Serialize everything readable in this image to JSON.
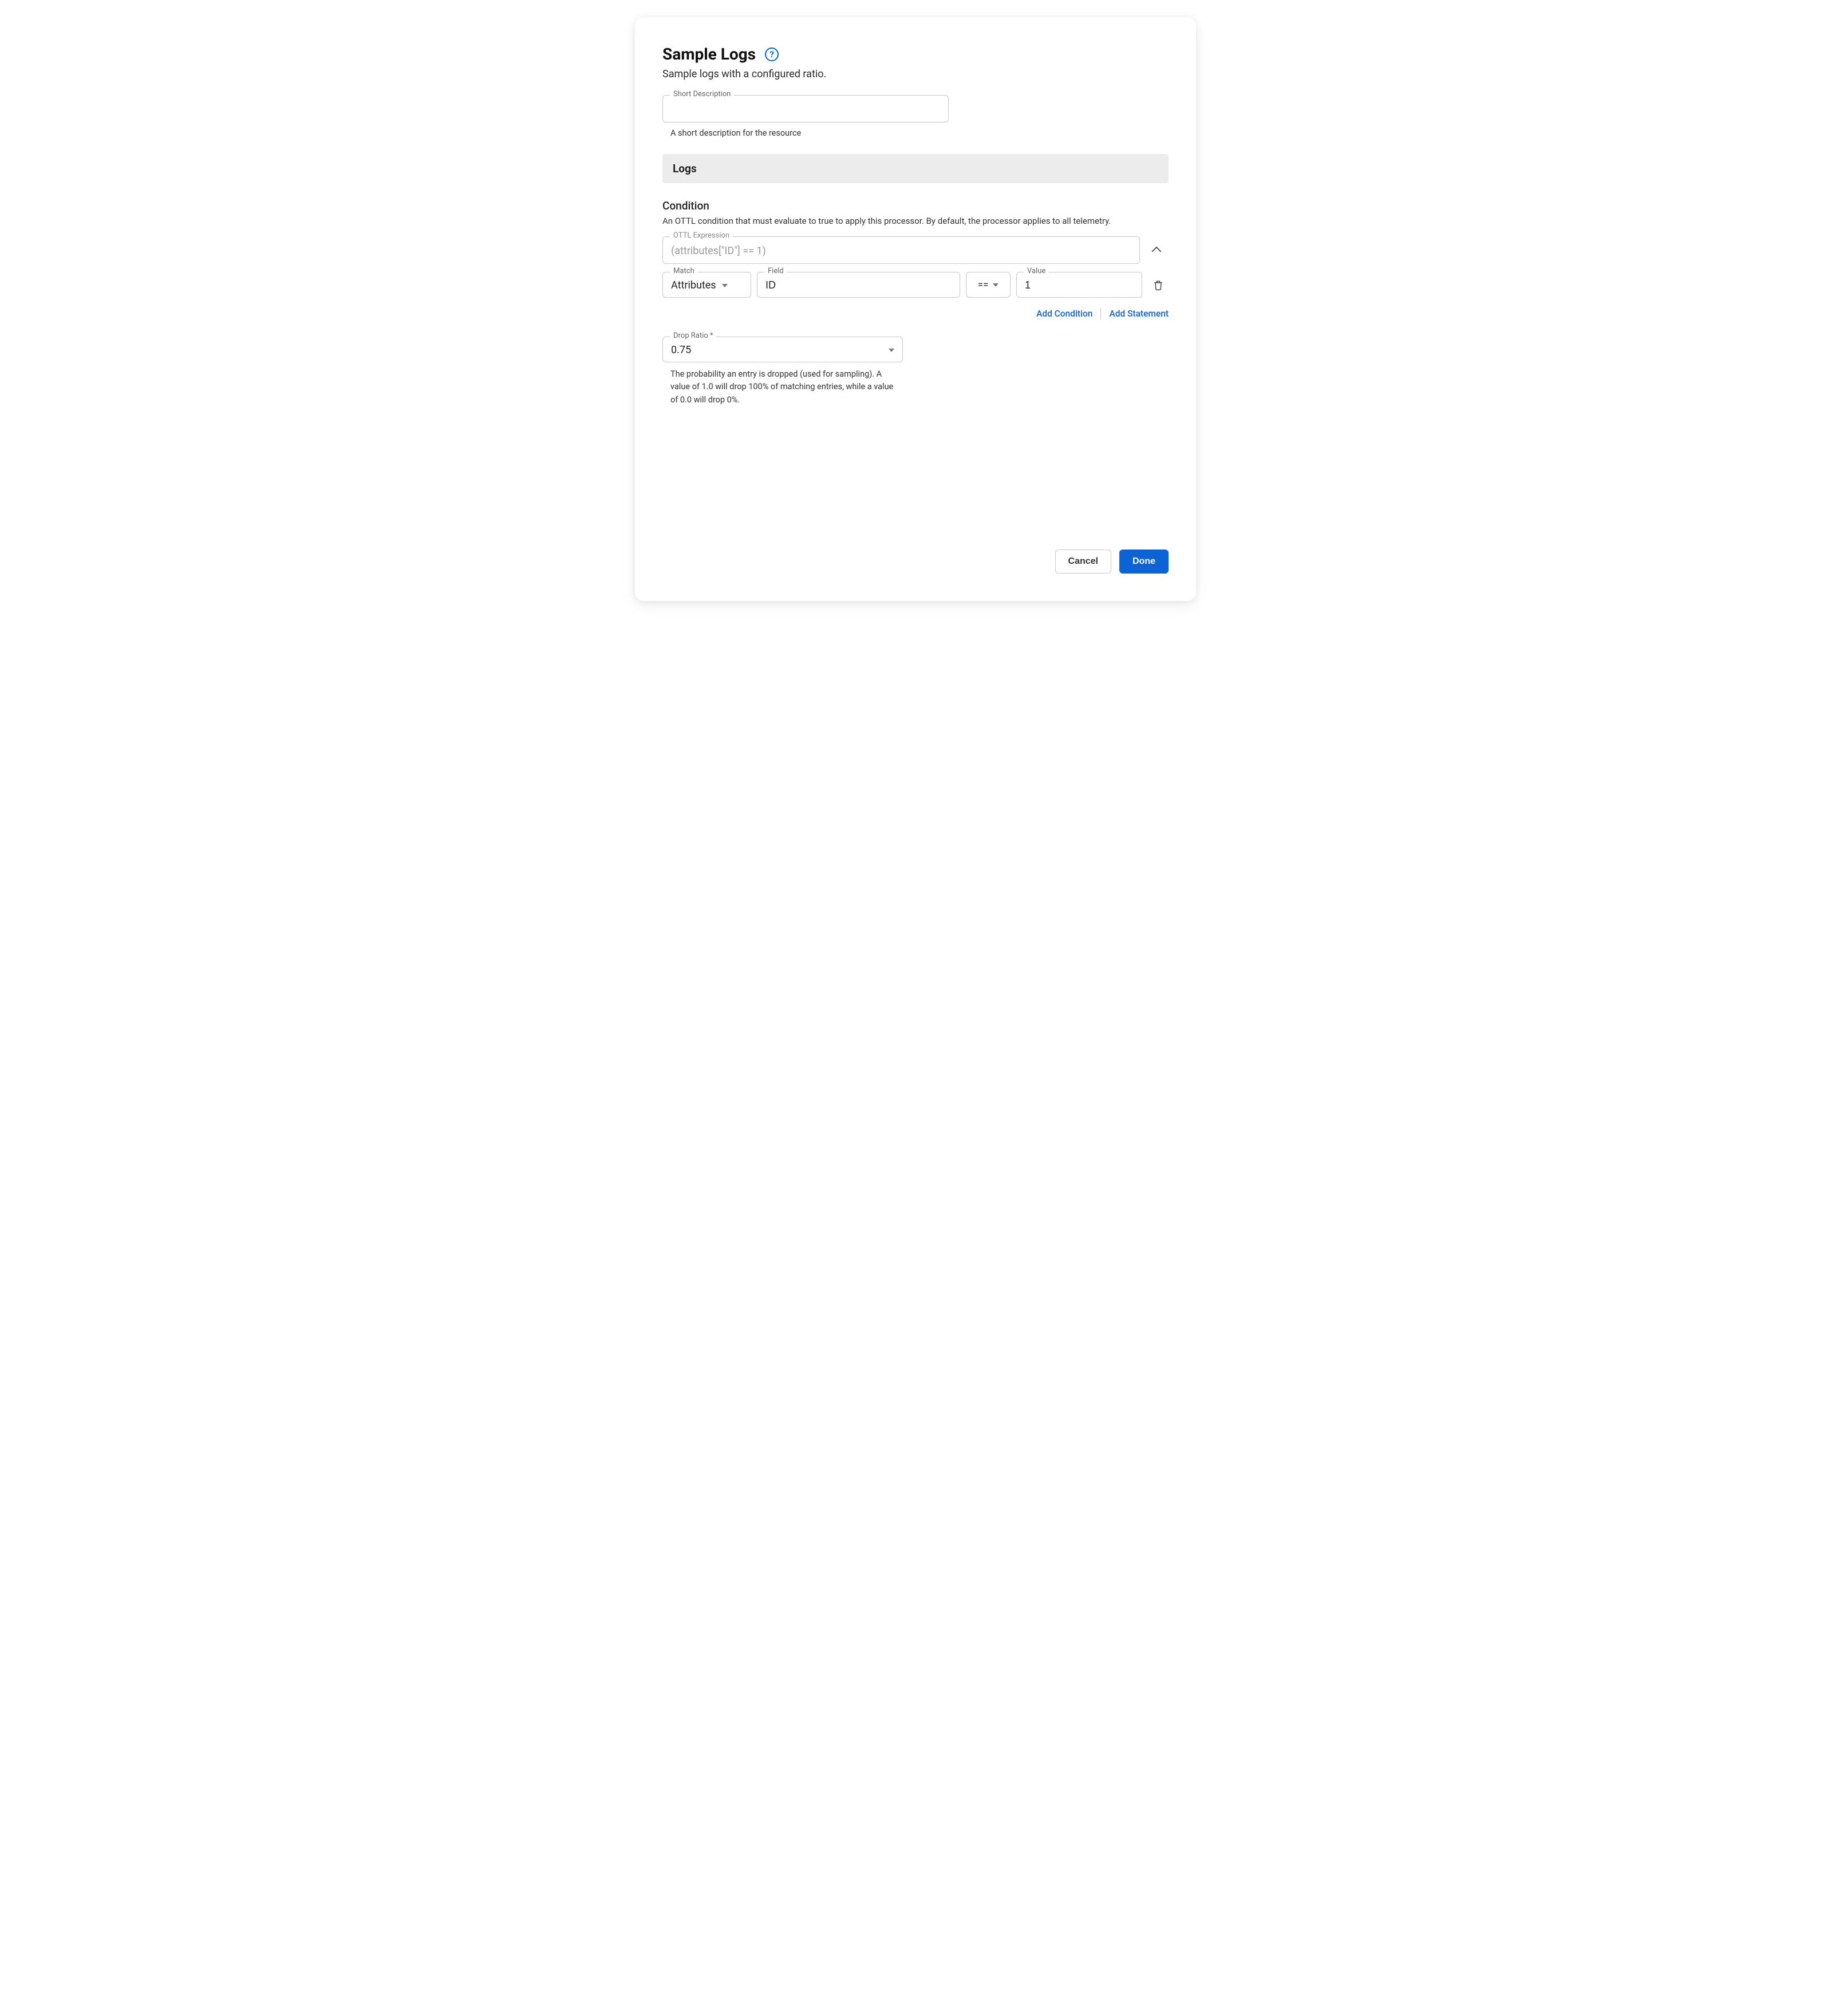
{
  "header": {
    "title": "Sample Logs",
    "help_icon_label": "?",
    "subtitle": "Sample logs with a configured ratio."
  },
  "short_description": {
    "label": "Short Description",
    "value": "",
    "helper": "A short description for the resource"
  },
  "section_bar": "Logs",
  "condition": {
    "heading": "Condition",
    "description": "An OTTL condition that must evaluate to true to apply this processor. By default, the processor applies to all telemetry.",
    "expression": {
      "label": "OTTL Expression",
      "value": "(attributes[\"ID\"] == 1)"
    },
    "match": {
      "label": "Match",
      "value": "Attributes"
    },
    "field": {
      "label": "Field",
      "value": "ID"
    },
    "operator": "==",
    "value_input": {
      "label": "Value",
      "value": "1"
    },
    "actions": {
      "add_condition": "Add Condition",
      "add_statement": "Add Statement"
    }
  },
  "drop_ratio": {
    "label": "Drop Ratio *",
    "value": "0.75",
    "helper": "The probability an entry is dropped (used for sampling). A value of 1.0 will drop 100% of matching entries, while a value of 0.0 will drop 0%."
  },
  "footer": {
    "cancel": "Cancel",
    "done": "Done"
  }
}
